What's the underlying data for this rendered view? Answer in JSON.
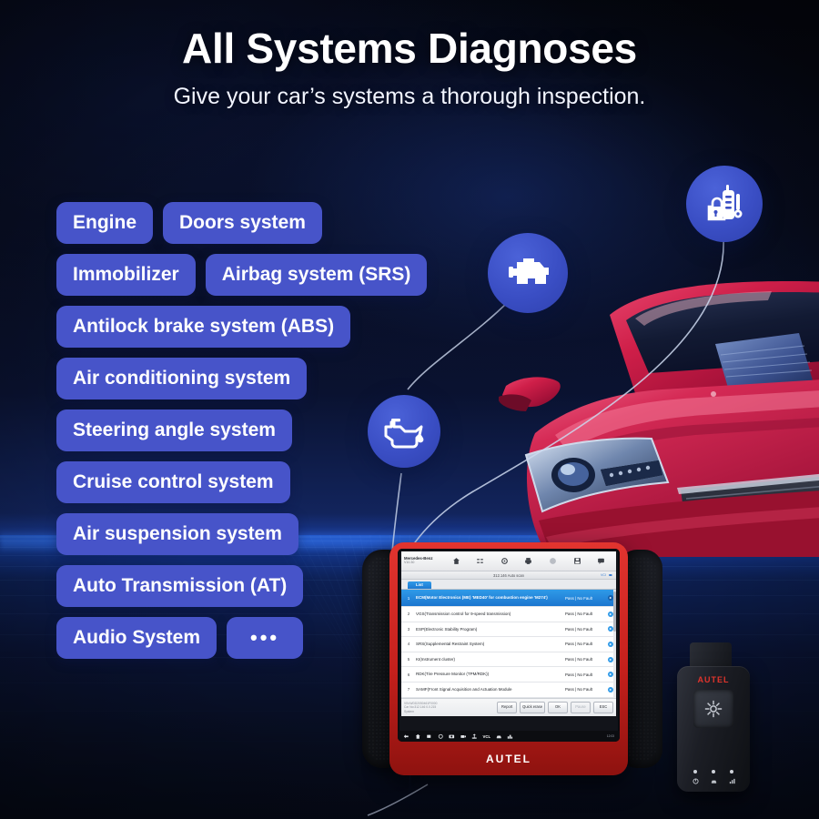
{
  "header": {
    "title": "All Systems Diagnoses",
    "subtitle": "Give your car’s systems a thorough inspection."
  },
  "colors": {
    "pill": "#4754c9",
    "bubble": "#3a4ec4",
    "accent_blue": "#1d79d0",
    "brand_red": "#e0342c",
    "horizon": "#1d4fbe"
  },
  "systems": {
    "rows": [
      [
        "Engine",
        "Doors system"
      ],
      [
        "Immobilizer",
        "Airbag system (SRS)"
      ],
      [
        "Antilock brake system (ABS)"
      ],
      [
        "Air conditioning system"
      ],
      [
        "Steering angle system"
      ],
      [
        "Cruise control system"
      ],
      [
        "Air suspension system"
      ],
      [
        "Auto Transmission (AT)"
      ],
      [
        "Audio System",
        "•••"
      ]
    ]
  },
  "bubbles": [
    {
      "name": "immobilizer-key-icon",
      "label": "Immobilizer key programming"
    },
    {
      "name": "engine-check-icon",
      "label": "Engine check"
    },
    {
      "name": "oil-can-icon",
      "label": "Oil service"
    }
  ],
  "tablet": {
    "brand": "AUTEL",
    "vehicle": {
      "name": "Mercedes-Benz",
      "version": "V10.30"
    },
    "breadcrumb": "312.146   Auto scan",
    "breadcrumb_right": "VCI",
    "tab_label": "List",
    "table": {
      "rows": [
        {
          "idx": "1",
          "name": "ECM(Motor Electronics (ME) 'MED40' for combustion engine 'M274')",
          "status": "Pass | No Fault",
          "selected": true
        },
        {
          "idx": "2",
          "name": "VGS(Transmission control for 9-speed transmission)",
          "status": "Pass | No Fault",
          "selected": false
        },
        {
          "idx": "3",
          "name": "ESP(Electronic Stability Program)",
          "status": "Pass | No Fault",
          "selected": false
        },
        {
          "idx": "4",
          "name": "SRS(Supplemental Restraint System)",
          "status": "Pass | No Fault",
          "selected": false
        },
        {
          "idx": "5",
          "name": "KI(Instrument cluster)",
          "status": "Pass | No Fault",
          "selected": false
        },
        {
          "idx": "6",
          "name": "RDK(Tire Pressure Monitor (TPM/RDK))",
          "status": "Pass | No Fault",
          "selected": false
        },
        {
          "idx": "7",
          "name": "SAMF(Front Signal Acquisition and Actuation Module",
          "status": "Pass | No Fault",
          "selected": false
        }
      ]
    },
    "footnote": "VIN:WDD2050461F0000\nCar No:312.146 0.0.215\nSystem",
    "buttons": [
      {
        "label": "Report",
        "disabled": false
      },
      {
        "label": "Quick erase",
        "disabled": false
      },
      {
        "label": "OK",
        "disabled": false
      },
      {
        "label": "Pause",
        "disabled": true
      },
      {
        "label": "ESC",
        "disabled": false
      }
    ],
    "navbar": {
      "vcl_label": "VCL",
      "time": "12:03"
    }
  },
  "vci": {
    "brand": "AUTEL"
  }
}
